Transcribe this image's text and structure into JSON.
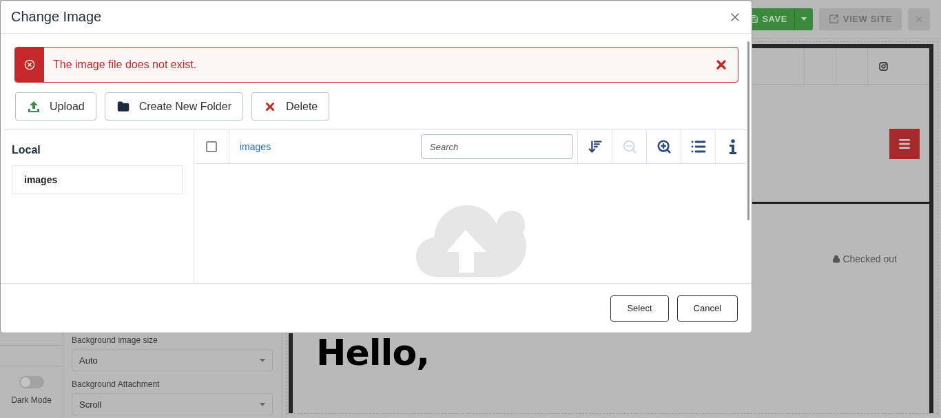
{
  "topbar": {
    "save_button": "SAVE",
    "view_site_button": "VIEW SITE"
  },
  "sidebar": {
    "toggle": {
      "label": "Dark Mode",
      "on": false
    },
    "fields": [
      {
        "label": "Background image size",
        "value": "Auto"
      },
      {
        "label": "Background Attachment",
        "value": "Scroll"
      }
    ]
  },
  "preview": {
    "status": "Checked out",
    "heading": "Hello,"
  },
  "modal": {
    "title": "Change Image",
    "alert": "The image file does not exist.",
    "actions": [
      {
        "kind": "upload",
        "label": "Upload"
      },
      {
        "kind": "folder",
        "label": "Create New Folder"
      },
      {
        "kind": "delete",
        "label": "Delete"
      }
    ],
    "tree": {
      "title": "Local",
      "items": [
        {
          "label": "images",
          "selected": true
        }
      ]
    },
    "browser": {
      "select_all": {
        "checked": false
      },
      "breadcrumb": [
        "images"
      ],
      "search": {
        "placeholder": "Search"
      },
      "tools": [
        {
          "kind": "sort",
          "disabled": false
        },
        {
          "kind": "zoom-out",
          "disabled": true
        },
        {
          "kind": "zoom-in",
          "disabled": false
        },
        {
          "kind": "list",
          "disabled": false
        },
        {
          "kind": "info",
          "disabled": false
        }
      ]
    },
    "footer_buttons": [
      "Select",
      "Cancel"
    ]
  }
}
